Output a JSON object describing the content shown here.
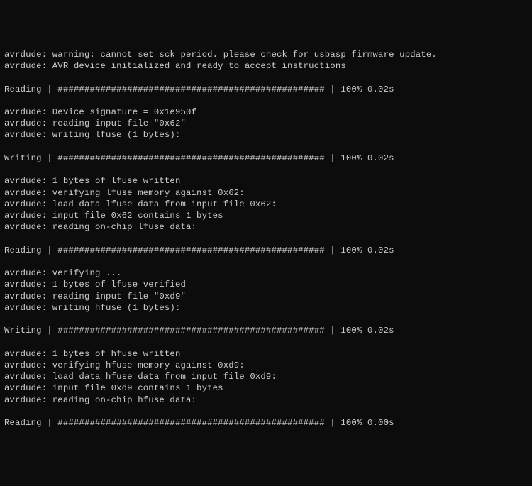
{
  "lines": [
    "avrdude: warning: cannot set sck period. please check for usbasp firmware update.",
    "avrdude: AVR device initialized and ready to accept instructions",
    "",
    "Reading | ################################################## | 100% 0.02s",
    "",
    "avrdude: Device signature = 0x1e950f",
    "avrdude: reading input file \"0x62\"",
    "avrdude: writing lfuse (1 bytes):",
    "",
    "Writing | ################################################## | 100% 0.02s",
    "",
    "avrdude: 1 bytes of lfuse written",
    "avrdude: verifying lfuse memory against 0x62:",
    "avrdude: load data lfuse data from input file 0x62:",
    "avrdude: input file 0x62 contains 1 bytes",
    "avrdude: reading on-chip lfuse data:",
    "",
    "Reading | ################################################## | 100% 0.02s",
    "",
    "avrdude: verifying ...",
    "avrdude: 1 bytes of lfuse verified",
    "avrdude: reading input file \"0xd9\"",
    "avrdude: writing hfuse (1 bytes):",
    "",
    "Writing | ################################################## | 100% 0.02s",
    "",
    "avrdude: 1 bytes of hfuse written",
    "avrdude: verifying hfuse memory against 0xd9:",
    "avrdude: load data hfuse data from input file 0xd9:",
    "avrdude: input file 0xd9 contains 1 bytes",
    "avrdude: reading on-chip hfuse data:",
    "",
    "Reading | ################################################## | 100% 0.00s"
  ]
}
